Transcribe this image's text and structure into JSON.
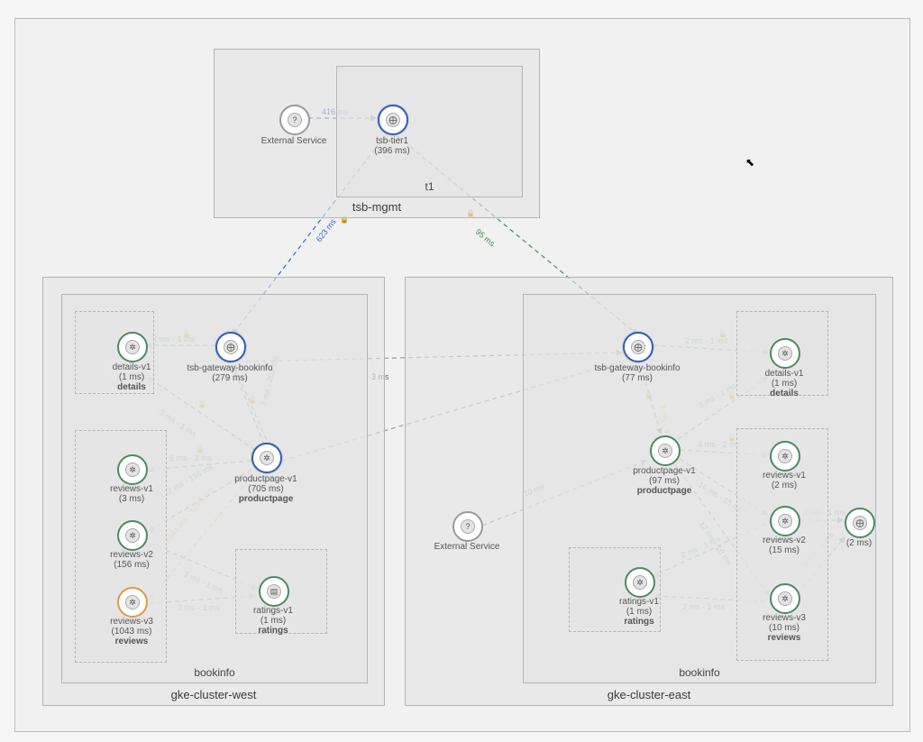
{
  "layout": {
    "top_box": {
      "label": "tsb-mgmt",
      "sub": {
        "label": "t1"
      }
    },
    "west_box": {
      "label": "gke-cluster-west",
      "sub": {
        "label": "bookinfo"
      }
    },
    "east_box": {
      "label": "gke-cluster-east",
      "sub": {
        "label": "bookinfo"
      }
    }
  },
  "nodes": {
    "ext_top": {
      "title": "External Service",
      "sub": ""
    },
    "tier1": {
      "title": "tsb-tier1",
      "sub": "(396 ms)"
    },
    "w_gateway": {
      "title": "tsb-gateway-bookinfo",
      "sub": "(279 ms)"
    },
    "w_details": {
      "title": "details-v1",
      "sub": "(1 ms)",
      "grp": "details"
    },
    "w_product": {
      "title": "productpage-v1",
      "sub": "(705 ms)",
      "grp": "productpage"
    },
    "w_rev1": {
      "title": "reviews-v1",
      "sub": "(3 ms)"
    },
    "w_rev2": {
      "title": "reviews-v2",
      "sub": "(156 ms)"
    },
    "w_rev3": {
      "title": "reviews-v3",
      "sub": "(1043 ms)",
      "grp": "reviews"
    },
    "w_ratings": {
      "title": "ratings-v1",
      "sub": "(1 ms)",
      "grp": "ratings"
    },
    "e_gateway": {
      "title": "tsb-gateway-bookinfo",
      "sub": "(77 ms)"
    },
    "e_details": {
      "title": "details-v1",
      "sub": "(1 ms)",
      "grp": "details"
    },
    "e_product": {
      "title": "productpage-v1",
      "sub": "(97 ms)",
      "grp": "productpage"
    },
    "e_rev1": {
      "title": "reviews-v1",
      "sub": "(2 ms)"
    },
    "e_rev2": {
      "title": "reviews-v2",
      "sub": "(15 ms)"
    },
    "e_rev3": {
      "title": "reviews-v3",
      "sub": "(10 ms)",
      "grp": "reviews"
    },
    "e_ratings": {
      "title": "ratings-v1",
      "sub": "(1 ms)",
      "grp": "ratings"
    },
    "ext_east": {
      "title": "External Service",
      "sub": ""
    },
    "e_extra": {
      "title": "",
      "sub": "(2 ms)"
    }
  },
  "edge_labels": {
    "ext_tier1": "416 ms",
    "tier1_wgw": "623 ms",
    "tier1_egw": "95 ms",
    "wgw_details": "3 ms - 1 ms",
    "wprod_details": "3 ms - 1 ms",
    "wprod_wgw_a": "3 ms - 202 ms",
    "wgw_egw": "3 ms",
    "wprod_rev1": "5 ms - 3 ms",
    "wprod_rev2": "157 ms - 156 ms",
    "wprod_rev3": "1044 ms - 1043 ms",
    "wrev2_ratings": "3 ms - 1 ms",
    "wrev3_ratings": "3 ms - 1 ms",
    "egw_details": "2 ms - 1 ms",
    "egw_eprod": "3 ms - 97 ms",
    "eprod_details": "3 ms - 1 ms",
    "eprod_rev1": "4 ms - 2 ms",
    "eprod_rev2": "16 ms - 15 ms",
    "eprod_rev3": "12 ms - 10 ms",
    "erev2_ratings": "2 ms - 1 ms",
    "erev3_ratings": "2 ms - 1 ms",
    "erev2_extra": "3 ms - 1 ms",
    "erev3_extra": "3 ms - 1 ms",
    "ext_eprod": "10 ms"
  }
}
